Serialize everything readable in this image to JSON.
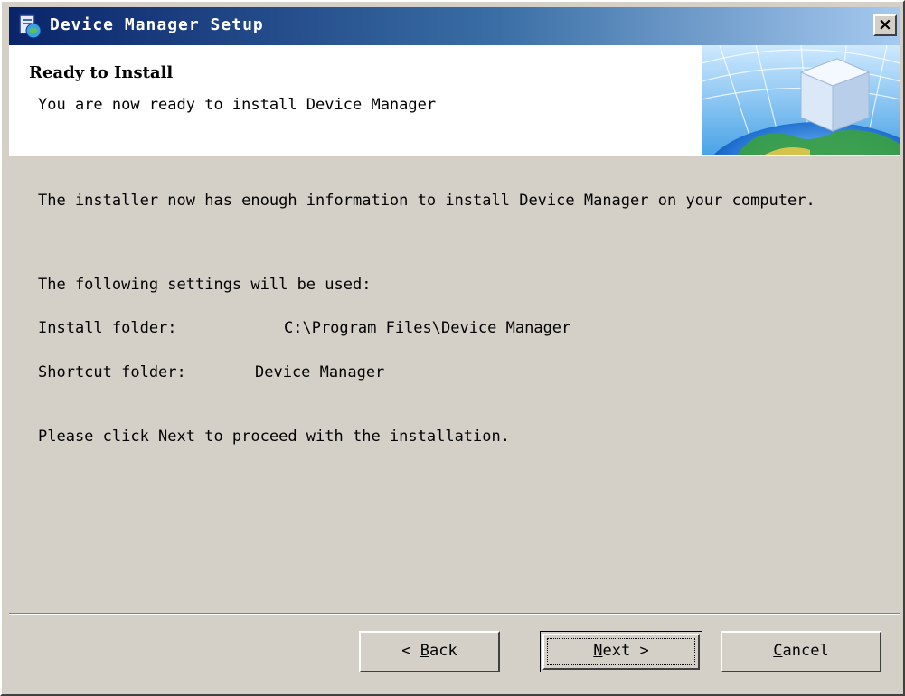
{
  "window": {
    "title": "Device Manager Setup",
    "close_label": "×"
  },
  "header": {
    "title": "Ready to Install",
    "subtitle": "You are now ready to install Device Manager"
  },
  "body": {
    "intro": "The installer now has enough information to install Device Manager on your computer.",
    "settings_heading": "The following settings will be used:",
    "settings": [
      {
        "label": "Install folder:",
        "value": "C:\\Program Files\\Device Manager"
      },
      {
        "label": "Shortcut folder:",
        "value": "Device Manager"
      }
    ],
    "instruction": "Please click Next to proceed with the installation."
  },
  "buttons": {
    "back": {
      "prefix": "< ",
      "mnemonic": "B",
      "rest": "ack"
    },
    "next": {
      "mnemonic": "N",
      "rest": "ext >"
    },
    "cancel": {
      "mnemonic": "C",
      "rest": "ancel"
    }
  },
  "icons": {
    "app": "setup-app-icon",
    "close": "close-icon",
    "banner": "globe-cube-graphic"
  },
  "colors": {
    "titlebar_start": "#0a246a",
    "titlebar_end": "#a6caf0",
    "dialog_bg": "#d4d0c8"
  }
}
